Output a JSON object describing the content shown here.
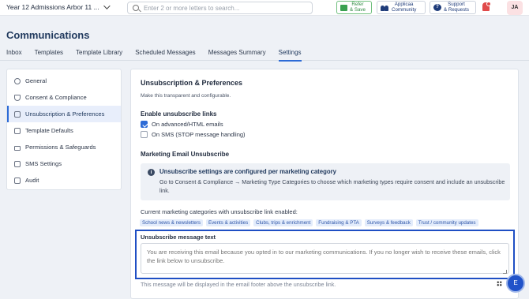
{
  "topbar": {
    "school_name": "Year 12 Admissions Arbor 11 ...",
    "search_placeholder": "Enter 2 or more letters to search...",
    "refer_label": "Refer\n& Save",
    "community_label": "Applicaa\nCommunity",
    "support_label": "Support\n& Requests",
    "support_icon_glyph": "?",
    "avatar_initials": "JA"
  },
  "page": {
    "title": "Communications"
  },
  "tabs": [
    {
      "label": "Inbox"
    },
    {
      "label": "Templates"
    },
    {
      "label": "Template Library"
    },
    {
      "label": "Scheduled Messages"
    },
    {
      "label": "Messages Summary"
    },
    {
      "label": "Settings"
    }
  ],
  "active_tab": "Settings",
  "sidebar": {
    "items": [
      {
        "label": "General",
        "icon": "gear-icon"
      },
      {
        "label": "Consent & Compliance",
        "icon": "shield-check-icon"
      },
      {
        "label": "Unsubscription & Preferences",
        "icon": "envelope-icon"
      },
      {
        "label": "Template Defaults",
        "icon": "document-icon"
      },
      {
        "label": "Permissions & Safeguards",
        "icon": "lock-icon"
      },
      {
        "label": "SMS Settings",
        "icon": "message-icon"
      },
      {
        "label": "Audit",
        "icon": "clipboard-icon"
      }
    ],
    "active": "Unsubscription & Preferences"
  },
  "main": {
    "title": "Unsubscription & Preferences",
    "subtitle": "Make this transparent and configurable.",
    "enable_links": {
      "heading": "Enable unsubscribe links",
      "options": [
        {
          "label": "On advanced/HTML emails",
          "checked": true
        },
        {
          "label": "On SMS (STOP message handling)",
          "checked": false
        }
      ]
    },
    "marketing": {
      "heading": "Marketing Email Unsubscribe",
      "info_icon_glyph": "i",
      "info_title": "Unsubscribe settings are configured per marketing category",
      "info_body": "Go to Consent & Compliance → Marketing Type Categories to choose which marketing types require consent and include an unsubscribe link.",
      "current_label": "Current marketing categories with unsubscribe link enabled:",
      "categories": [
        "School news & newsletters",
        "Events & activities",
        "Clubs, trips & enrichment",
        "Fundraising & PTA",
        "Surveys & feedback",
        "Trust / community updates"
      ]
    },
    "message": {
      "label": "Unsubscribe message text",
      "value": "You are receiving this email because you opted in to our marketing communications. If you no longer wish to receive these emails, click the link below to unsubscribe.",
      "helper": "This message will be displayed in the email footer above the unsubscribe link."
    }
  },
  "fab_label": "E",
  "colors": {
    "accent": "#2d6bd6",
    "highlight_border": "#1f4fc4",
    "title": "#213a5e"
  }
}
